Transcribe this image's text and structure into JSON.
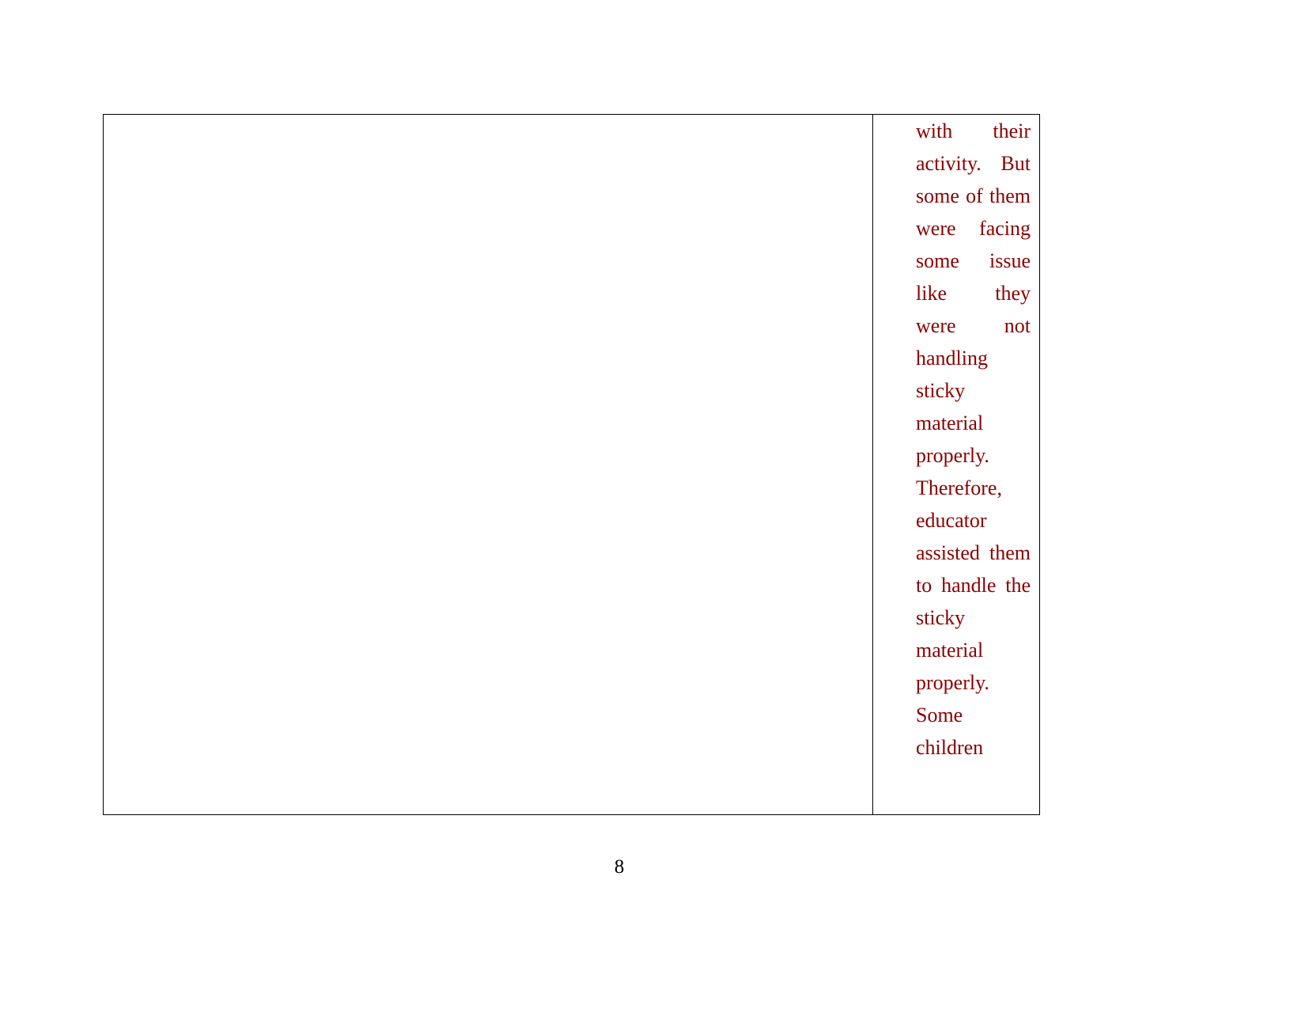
{
  "document": {
    "page_number": "8",
    "text_color": "#8B0000",
    "border_color": "#000000",
    "table": {
      "left_cell": {
        "content": ""
      },
      "right_cell": {
        "paragraph": "with their activity. But some of them were facing some issue like they were not handling sticky material properly. Therefore, educator assisted them to handle the sticky material properly. Some children",
        "lines": [
          "with their",
          "activity.",
          "But some of",
          "them were",
          "facing some",
          "issue like",
          "they were",
          "not",
          "handling",
          "sticky",
          "material",
          "properly.",
          "Therefore,",
          "educator",
          "assisted",
          "them to",
          "handle the",
          "sticky",
          "material",
          "properly.",
          "Some",
          "children"
        ]
      }
    }
  }
}
